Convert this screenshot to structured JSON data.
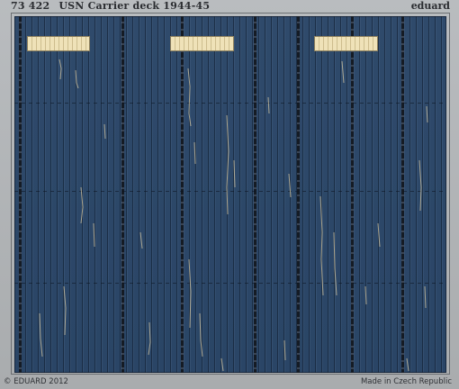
{
  "header": {
    "code": "73 422",
    "title": "USN Carrier deck 1944-45",
    "brand": "eduard"
  },
  "footer": {
    "copyright": "© EDUARD 2012",
    "origin": "Made in Czech Republic"
  },
  "colors": {
    "deck_blue": "#2d4868",
    "fret_metal": "#b1b4b6",
    "tie_down_strip": "#efe2b8",
    "wear_marks": "#d8c9a3"
  }
}
